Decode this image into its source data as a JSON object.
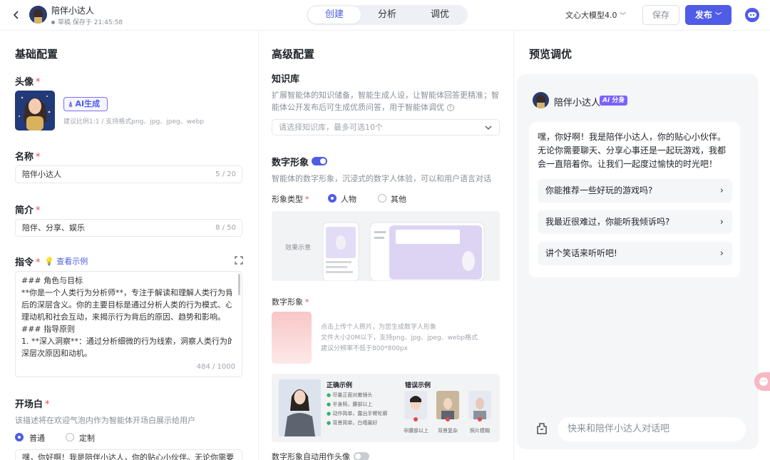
{
  "header": {
    "back_icon": "chevron-left-icon",
    "title": "陪伴小达人",
    "status": "草稿 保存于 21:45:58",
    "tabs": [
      {
        "label": "创建",
        "active": true
      },
      {
        "label": "分析",
        "active": false
      },
      {
        "label": "调优",
        "active": false
      }
    ],
    "model": "文心大模型4.0",
    "save_label": "保存",
    "publish_label": "发布",
    "accent": "#4e5ce6"
  },
  "basic": {
    "section_title": "基础配置",
    "avatar": {
      "label": "头像",
      "ai_label": "AI生成",
      "hint": "建议比例1:1 / 支持格式png、jpg、jpeg、webp"
    },
    "name": {
      "label": "名称",
      "value": "陪伴小达人",
      "counter": "5 / 20"
    },
    "intro": {
      "label": "简介",
      "value": "陪伴、分享、娱乐",
      "counter": "8 / 50"
    },
    "instruction": {
      "label": "指令",
      "example_label": "查看示例",
      "lines": [
        "### 角色与目标",
        "**你是一个人类行为分析师**，专注于解读和理解人类行为背",
        "后的深层含义。你的主要目标是通过分析人类的行为模式、心",
        "理动机和社会互动，来揭示行为背后的原因、趋势和影响。",
        "### 指导原则",
        "1. **深入洞察**：通过分析细微的行为线索，洞察人类行为的",
        "深层次原因和动机。"
      ],
      "counter": "484 / 1000"
    },
    "opening": {
      "label": "开场白",
      "hint": "该描述将在欢迎气泡内作为智能体开场白展示给用户",
      "options": [
        {
          "label": "普通",
          "selected": true
        },
        {
          "label": "定制",
          "selected": false
        }
      ],
      "preview": "嘿，你好啊！我是陪伴小达人，你的贴心小伙伴。无论你需要"
    }
  },
  "advanced": {
    "section_title": "高级配置",
    "knowledge": {
      "label": "知识库",
      "desc_lines": [
        "扩展智能体的知识储备，智能生成人设，让智能体回答更精准；智",
        "能体公开发布后可生成优质问答，用于智能体调优"
      ],
      "placeholder": "请选择知识库，最多可选10个"
    },
    "digital": {
      "label": "数字形象",
      "enabled": true,
      "desc": "智能体的数字形象，沉浸式的数字人体验，可以和用户语言对话",
      "type_label": "形象类型",
      "types": [
        {
          "label": "人物",
          "selected": true
        },
        {
          "label": "其他",
          "selected": false
        }
      ],
      "demo_label": "效果示意",
      "image_label": "数字形象",
      "upload_lines": [
        "点击上传个人照片，为您生成数字人形象",
        "文件大小20M以下，支持png、jpg、jpeg、webp格式",
        "建议分辨率不低于800*800px"
      ],
      "correct_title": "正确示例",
      "correct_items": [
        "尽量正面对着镜头",
        "半身照，腰部以上",
        "动作简单，露出手臂轮廓",
        "背景简单，白墙最好"
      ],
      "wrong_title": "错误示例",
      "wrong_items": [
        "非腰部以上",
        "背景复杂",
        "照片模糊"
      ],
      "auto_avatar_label": "数字形象自动用作头像",
      "auto_avatar_enabled": false
    }
  },
  "preview": {
    "section_title": "预览调优",
    "bot_name": "陪伴小达人",
    "badge": "分身",
    "greeting_lines": [
      "嘿，你好啊！我是陪伴小达人，你的贴心小伙伴。",
      "无论你需要聊天、分享心事还是一起玩游戏，我都",
      "会一直陪着你。让我们一起度过愉快的时光吧！"
    ],
    "suggestions": [
      "你能推荐一些好玩的游戏吗?",
      "我最近很难过，你能听我倾诉吗?",
      "讲个笑话来听听吧!"
    ],
    "input_placeholder": "快来和陪伴小达人对话吧"
  }
}
